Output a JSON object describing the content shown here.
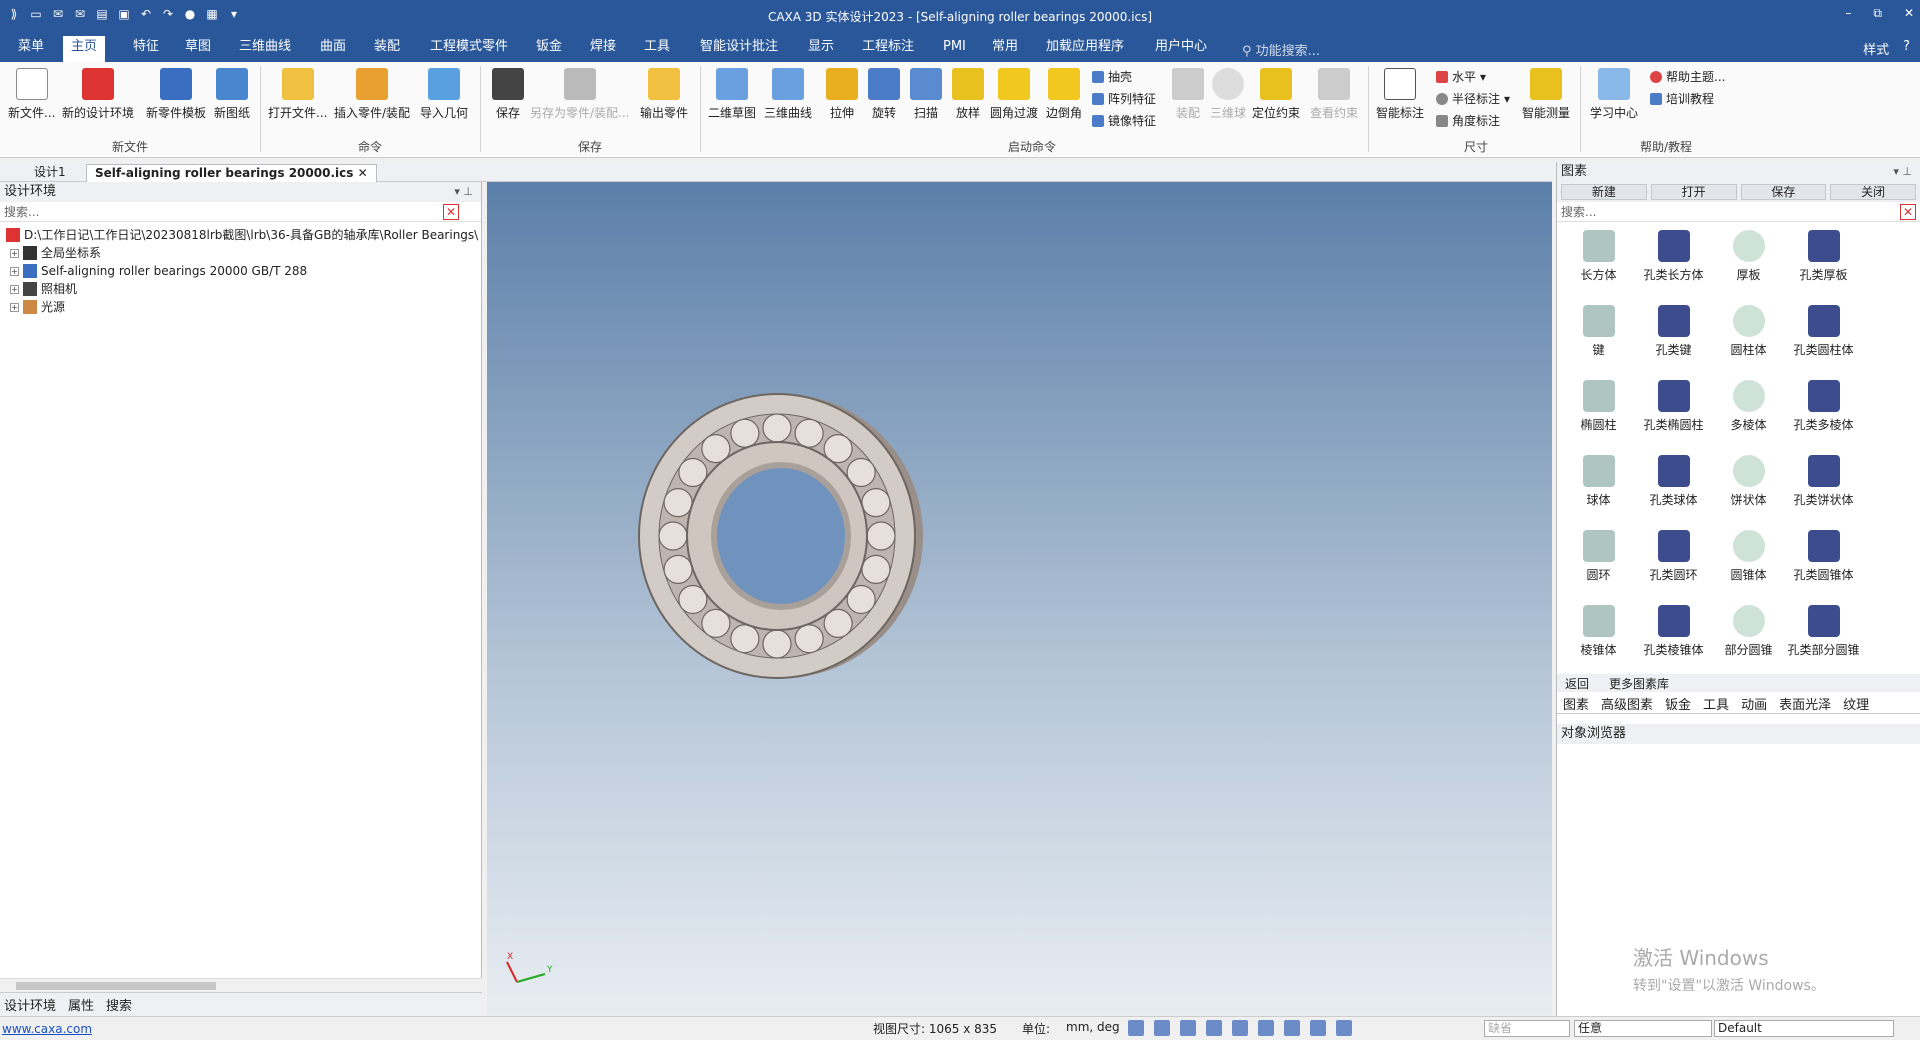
{
  "titlebar": {
    "title": "CAXA 3D 实体设计2023 - [Self-aligning roller bearings 20000.ics]",
    "minimize": "–",
    "restore": "⧉",
    "close": "✕"
  },
  "menu_tabs": [
    "菜单",
    "主页",
    "特征",
    "草图",
    "三维曲线",
    "曲面",
    "装配",
    "工程模式零件",
    "钣金",
    "焊接",
    "工具",
    "智能设计批注",
    "显示",
    "工程标注",
    "PMI",
    "常用",
    "加载应用程序",
    "用户中心"
  ],
  "active_tab": "主页",
  "search_placeholder": "功能搜索...",
  "menu_right": {
    "style": "样式",
    "help": "?"
  },
  "ribbon": {
    "groups": [
      "新文件",
      "命令",
      "保存",
      "启动命令",
      "尺寸",
      "帮助/教程"
    ],
    "new_file": [
      "新文件...",
      "新的设计环境",
      "新零件模板",
      "新图纸"
    ],
    "command": [
      "打开文件...",
      "插入零件/装配",
      "导入几何"
    ],
    "save": [
      "保存",
      "另存为零件/装配...",
      "输出零件"
    ],
    "launch": [
      "二维草图",
      "三维曲线",
      "拉伸",
      "旋转",
      "扫描",
      "放样",
      "圆角过渡",
      "边倒角"
    ],
    "launch_small": [
      "抽壳",
      "阵列特征",
      "镜像特征"
    ],
    "launch_dis": [
      "装配",
      "三维球",
      "定位约束",
      "查看约束"
    ],
    "dim": [
      "智能标注"
    ],
    "dim_small": [
      "水平",
      "半径标注",
      "角度标注"
    ],
    "dim2": [
      "智能测量"
    ],
    "help": [
      "学习中心"
    ],
    "help_small": [
      "帮助主题...",
      "培训教程"
    ]
  },
  "doc_tabs": [
    "设计1",
    "Self-aligning roller bearings 20000.ics"
  ],
  "left": {
    "title": "设计环境",
    "search": "搜索...",
    "tree": [
      "D:\\工作日记\\工作日记\\20230818lrb截图\\lrb\\36-具备GB的轴承库\\Roller Bearings\\",
      "全局坐标系",
      "Self-aligning roller bearings 20000 GB/T 288",
      "照相机",
      "光源"
    ],
    "tabs": [
      "设计环境",
      "属性",
      "搜索"
    ]
  },
  "right": {
    "title": "图素",
    "buttons": [
      "新建",
      "打开",
      "保存",
      "关闭"
    ],
    "search": "搜索...",
    "items": [
      "长方体",
      "孔类长方体",
      "厚板",
      "孔类厚板",
      "键",
      "孔类键",
      "圆柱体",
      "孔类圆柱体",
      "椭圆柱",
      "孔类椭圆柱",
      "多棱体",
      "孔类多棱体",
      "球体",
      "孔类球体",
      "饼状体",
      "孔类饼状体",
      "圆环",
      "孔类圆环",
      "圆锥体",
      "孔类圆锥体",
      "棱锥体",
      "孔类棱锥体",
      "部分圆锥",
      "孔类部分圆锥"
    ],
    "nav": [
      "返回",
      "更多图素库"
    ],
    "tabs": [
      "图素",
      "高级图素",
      "钣金",
      "工具",
      "动画",
      "表面光泽",
      "纹理"
    ],
    "obj_title": "对象浏览器",
    "watermark1": "激活 Windows",
    "watermark2": "转到\"设置\"以激活 Windows。"
  },
  "status": {
    "link": "www.caxa.com",
    "dims": "视图尺寸: 1065 x  835",
    "unit_label": "单位:",
    "unit_value": "mm, deg",
    "combo1": "缺省",
    "combo2": "任意",
    "combo3": "Default"
  },
  "axes": {
    "x": "X",
    "y": "Y"
  }
}
